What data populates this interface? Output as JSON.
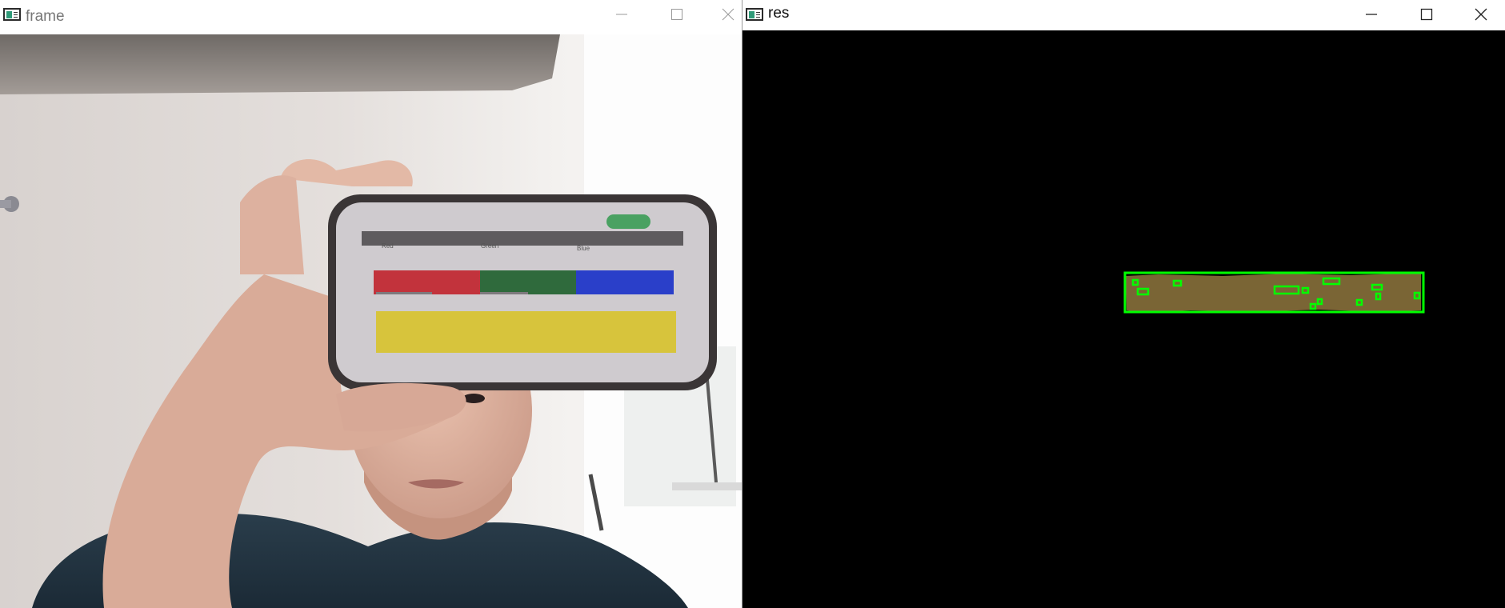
{
  "windows": {
    "frame": {
      "title": "frame"
    },
    "res": {
      "title": "res"
    }
  },
  "icons": {
    "app": "opencv-window-icon",
    "minimize": "minimize-icon",
    "maximize": "maximize-icon",
    "close": "close-icon"
  },
  "colors": {
    "mask_fill": "#7a6535",
    "detection_box": "#00ff00",
    "res_background": "#000000"
  },
  "phone_screen": {
    "labels": [
      "Red",
      "Green",
      "Blue"
    ]
  }
}
